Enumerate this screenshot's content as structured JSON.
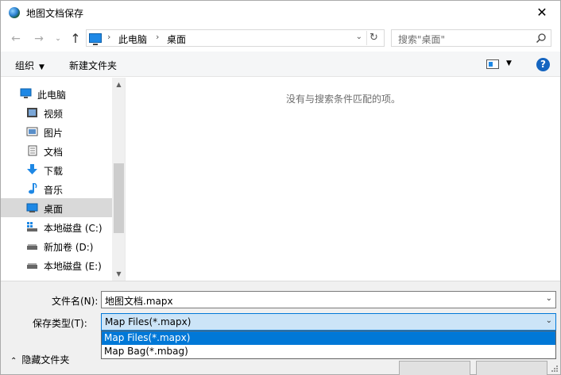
{
  "window": {
    "title": "地图文档保存",
    "close": "✕"
  },
  "nav": {
    "back": "←",
    "forward": "→",
    "recent": "⌄",
    "up": "↑",
    "address_sep": "›",
    "breadcrumbs": [
      "此电脑",
      "桌面"
    ],
    "address_dropdown": "⌄",
    "refresh": "↻",
    "search_placeholder": "搜索\"桌面\""
  },
  "toolbar": {
    "organize": "组织",
    "organize_caret": "▼",
    "new_folder": "新建文件夹",
    "view_caret": "▼",
    "help": "?"
  },
  "tree": [
    {
      "label": "此电脑",
      "icon": "computer-icon",
      "selected": false
    },
    {
      "label": "视频",
      "icon": "video-folder-icon",
      "selected": false
    },
    {
      "label": "图片",
      "icon": "pictures-folder-icon",
      "selected": false
    },
    {
      "label": "文档",
      "icon": "documents-folder-icon",
      "selected": false
    },
    {
      "label": "下载",
      "icon": "download-arrow-icon",
      "selected": false
    },
    {
      "label": "音乐",
      "icon": "music-note-icon",
      "selected": false
    },
    {
      "label": "桌面",
      "icon": "desktop-icon",
      "selected": true
    },
    {
      "label": "本地磁盘 (C:)",
      "icon": "system-drive-icon",
      "selected": false
    },
    {
      "label": "新加卷 (D:)",
      "icon": "drive-icon",
      "selected": false
    },
    {
      "label": "本地磁盘 (E:)",
      "icon": "drive-icon",
      "selected": false
    }
  ],
  "scrollbar": {
    "up": "▲",
    "down": "▼"
  },
  "content": {
    "empty_message": "没有与搜索条件匹配的项。"
  },
  "form": {
    "filename_label": "文件名(N):",
    "filename_value": "地图文档.mapx",
    "filetype_label": "保存类型(T):",
    "filetype_value": "Map Files(*.mapx)",
    "chevron": "⌄",
    "filetype_options": [
      "Map Files(*.mapx)",
      "Map Bag(*.mbag)"
    ],
    "hide_folders": "隐藏文件夹",
    "hide_chevron": "⌃"
  },
  "colors": {
    "accent": "#0078d7",
    "selection_bg": "#cce4f7",
    "tree_selected": "#d9d9d9"
  }
}
